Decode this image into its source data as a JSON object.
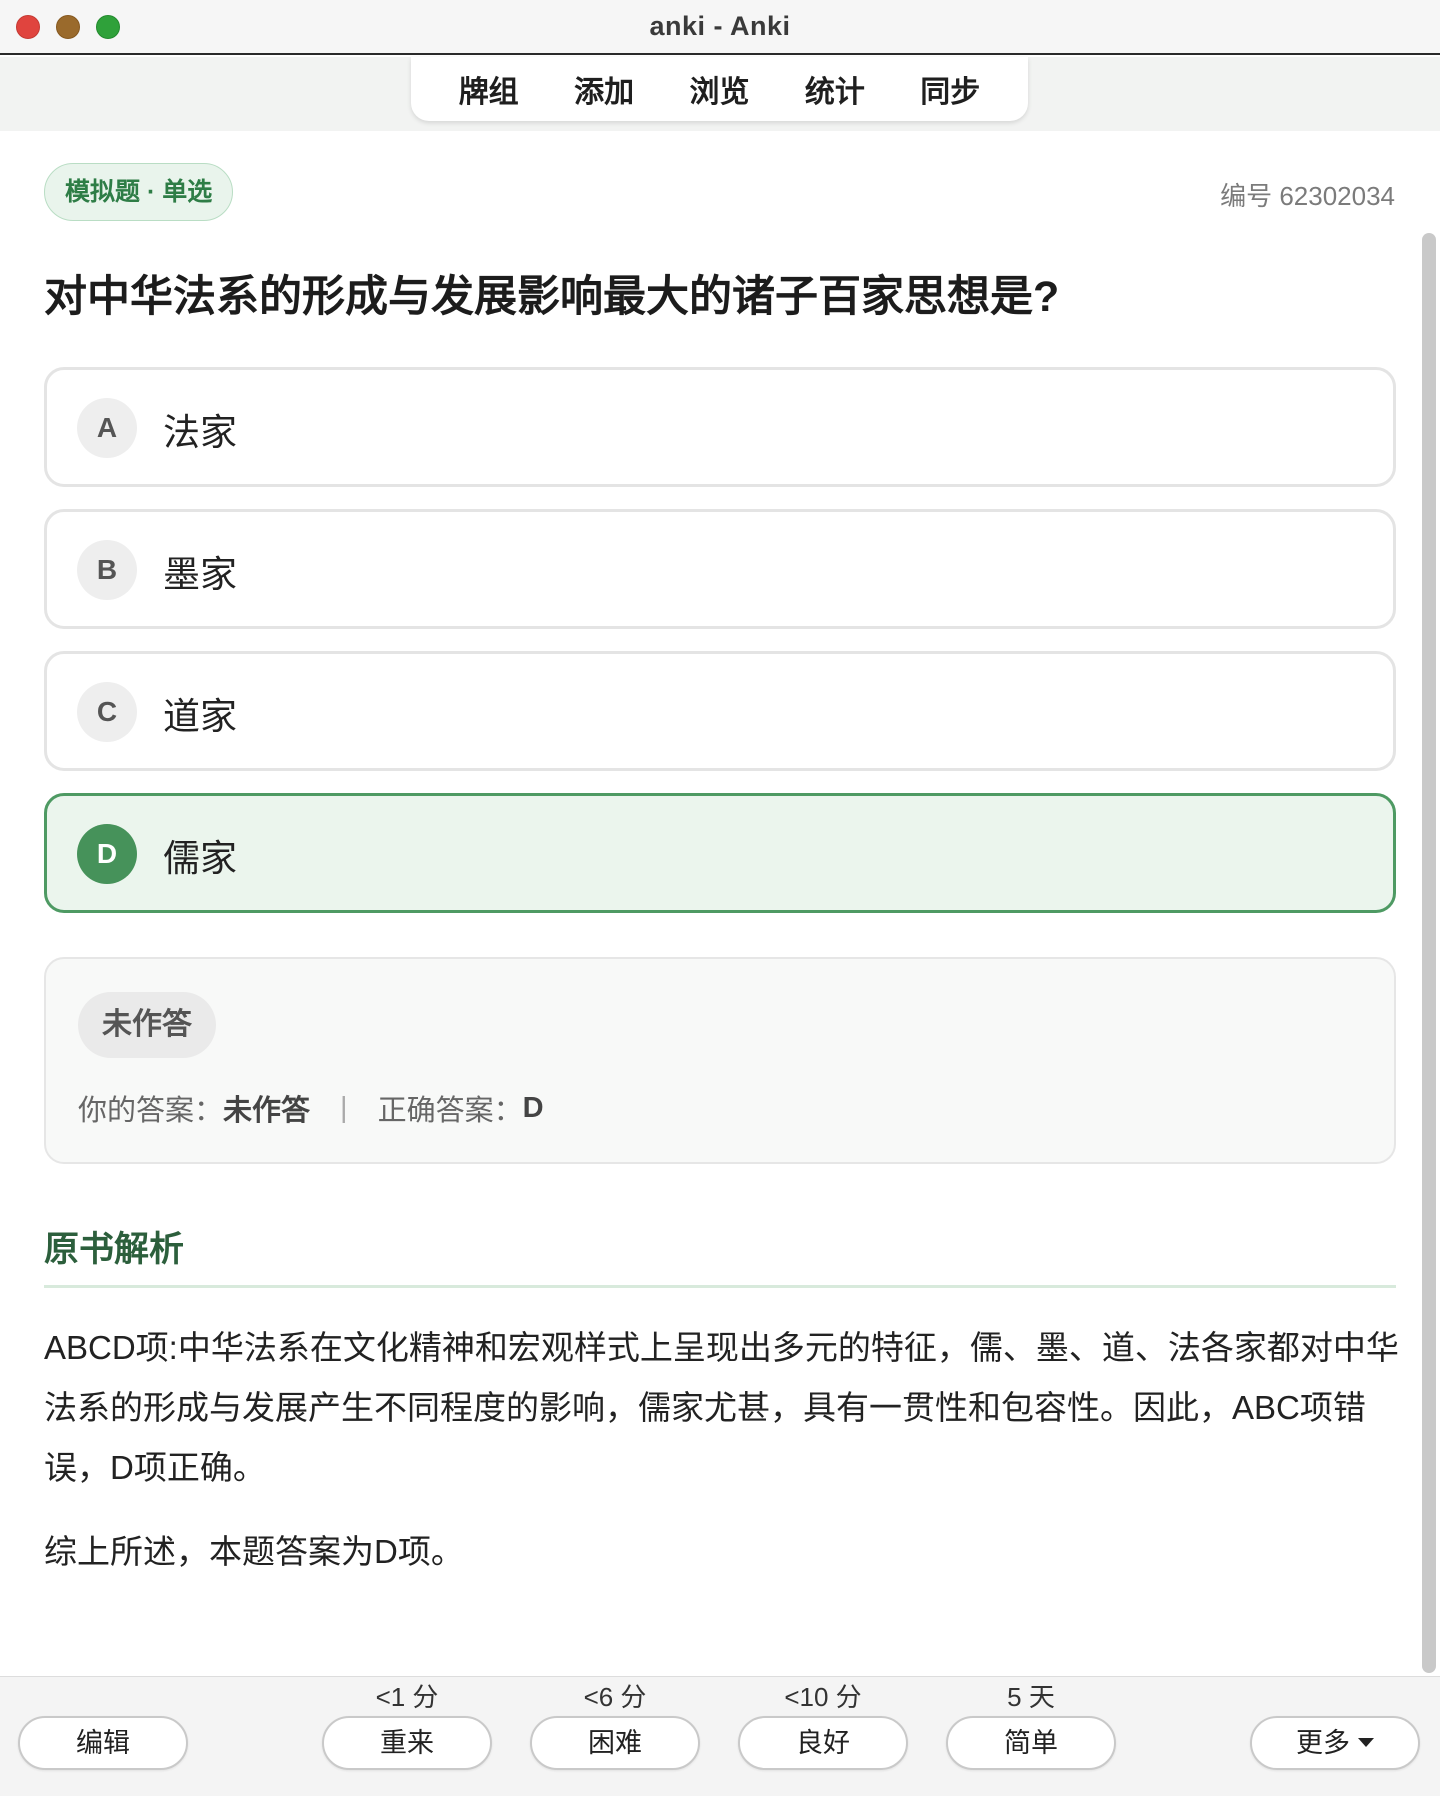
{
  "window": {
    "title": "anki - Anki"
  },
  "toolbar": {
    "items": [
      "牌组",
      "添加",
      "浏览",
      "统计",
      "同步"
    ]
  },
  "card": {
    "type_badge": "模拟题 · 单选",
    "id": "编号 62302034",
    "question": "对中华法系的形成与发展影响最大的诸子百家思想是?",
    "options": [
      {
        "letter": "A",
        "text": "法家"
      },
      {
        "letter": "B",
        "text": "墨家"
      },
      {
        "letter": "C",
        "text": "道家"
      },
      {
        "letter": "D",
        "text": "儒家"
      }
    ],
    "correct_option": "D",
    "colors": {
      "accent": "#46925a",
      "correct_bg": "#ebf5ed",
      "section_title": "#2c5f3c"
    }
  },
  "result": {
    "status": "未作答",
    "your_answer_label": "你的答案：",
    "your_answer": "未作答",
    "separator": "|",
    "correct_label": "正确答案：",
    "correct_answer": "D"
  },
  "explanation": {
    "title": "原书解析",
    "body": "ABCD项:中华法系在文化精神和宏观样式上呈现出多元的特征，儒、墨、道、法各家都对中华法系的形成与发展产生不同程度的影响，儒家尤甚，具有一贯性和包容性。因此，ABC项错误，D项正确。",
    "summary": "综上所述，本题答案为D项。"
  },
  "bottom": {
    "edit": "编辑",
    "more": "更多",
    "answers": [
      {
        "interval": "<1 分",
        "label": "重来"
      },
      {
        "interval": "<6 分",
        "label": "困难"
      },
      {
        "interval": "<10 分",
        "label": "良好"
      },
      {
        "interval": "5 天",
        "label": "简单"
      }
    ]
  }
}
